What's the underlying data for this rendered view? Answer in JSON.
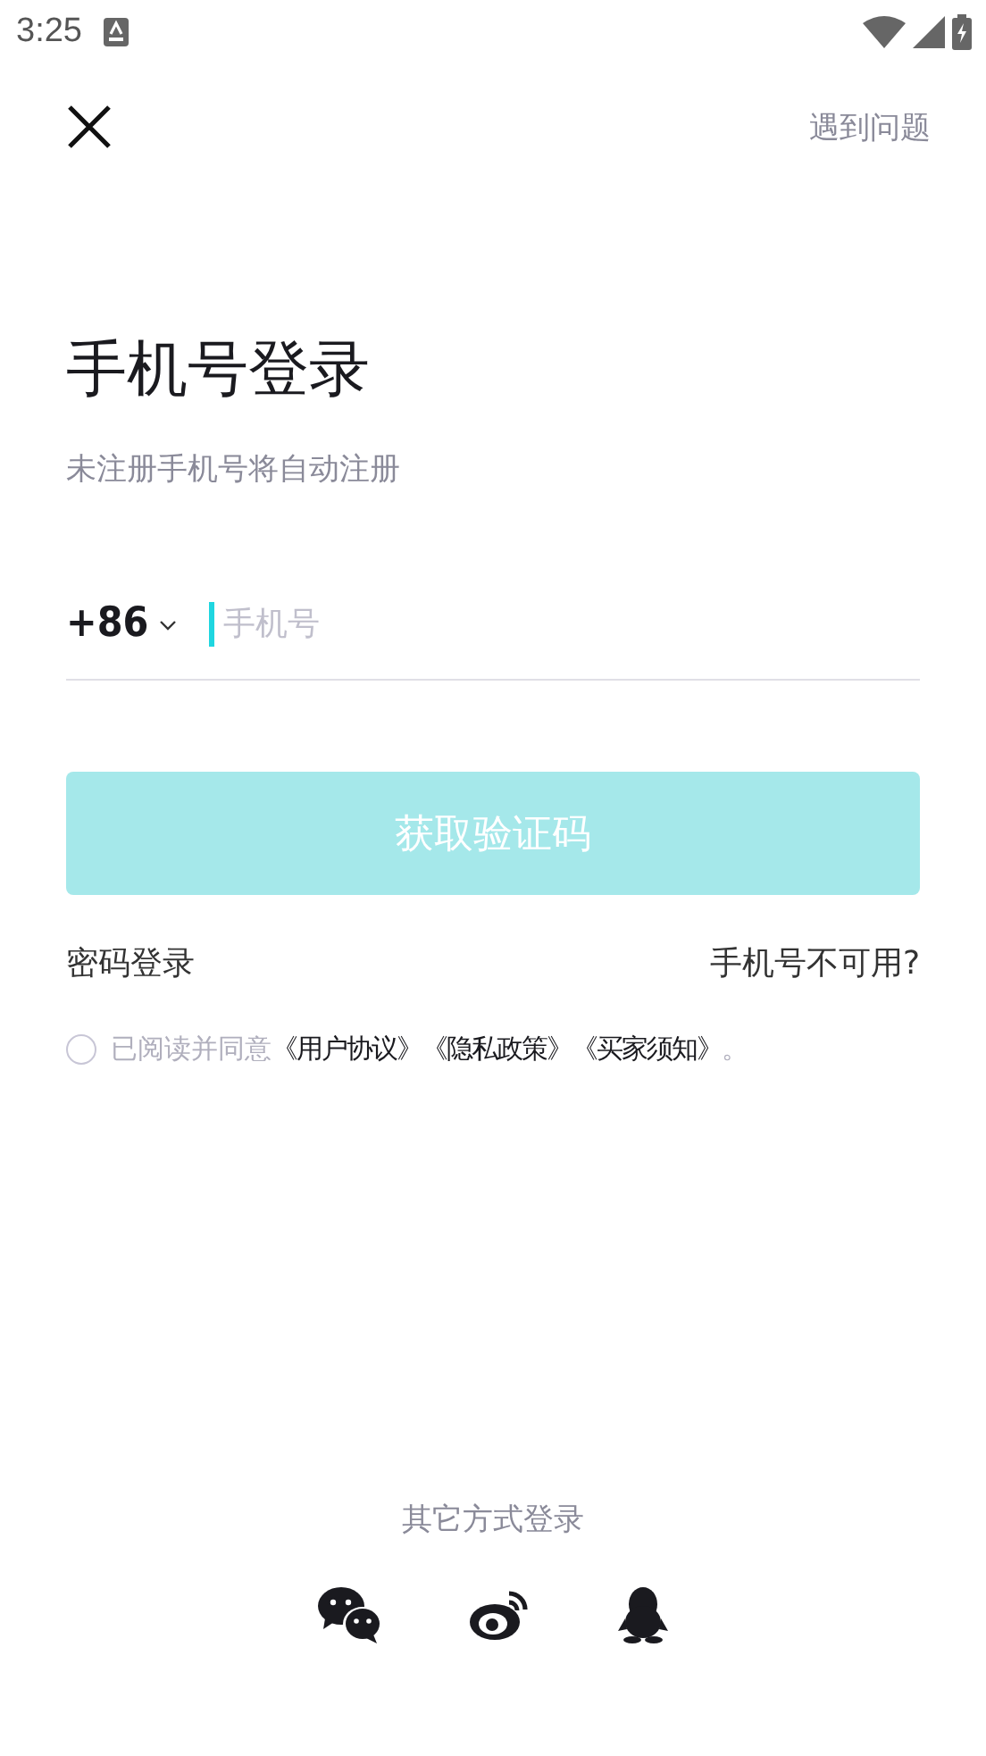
{
  "status_bar": {
    "time": "3:25"
  },
  "header": {
    "help_link": "遇到问题"
  },
  "title": "手机号登录",
  "subtitle": "未注册手机号将自动注册",
  "phone": {
    "country_code": "+86",
    "placeholder": "手机号"
  },
  "submit_button": {
    "label": "获取验证码",
    "disabled": true
  },
  "links": [
    "密码登录",
    "手机号不可用?"
  ],
  "agreement": {
    "checked": false,
    "prefix": "已阅读并同意",
    "documents": [
      "《用户协议》",
      "《隐私政策》",
      "《买家须知》"
    ],
    "suffix": "。"
  },
  "other_login": {
    "label": "其它方式登录",
    "providers": [
      {
        "kind": "wechat"
      },
      {
        "kind": "weibo"
      },
      {
        "kind": "qq"
      }
    ]
  }
}
